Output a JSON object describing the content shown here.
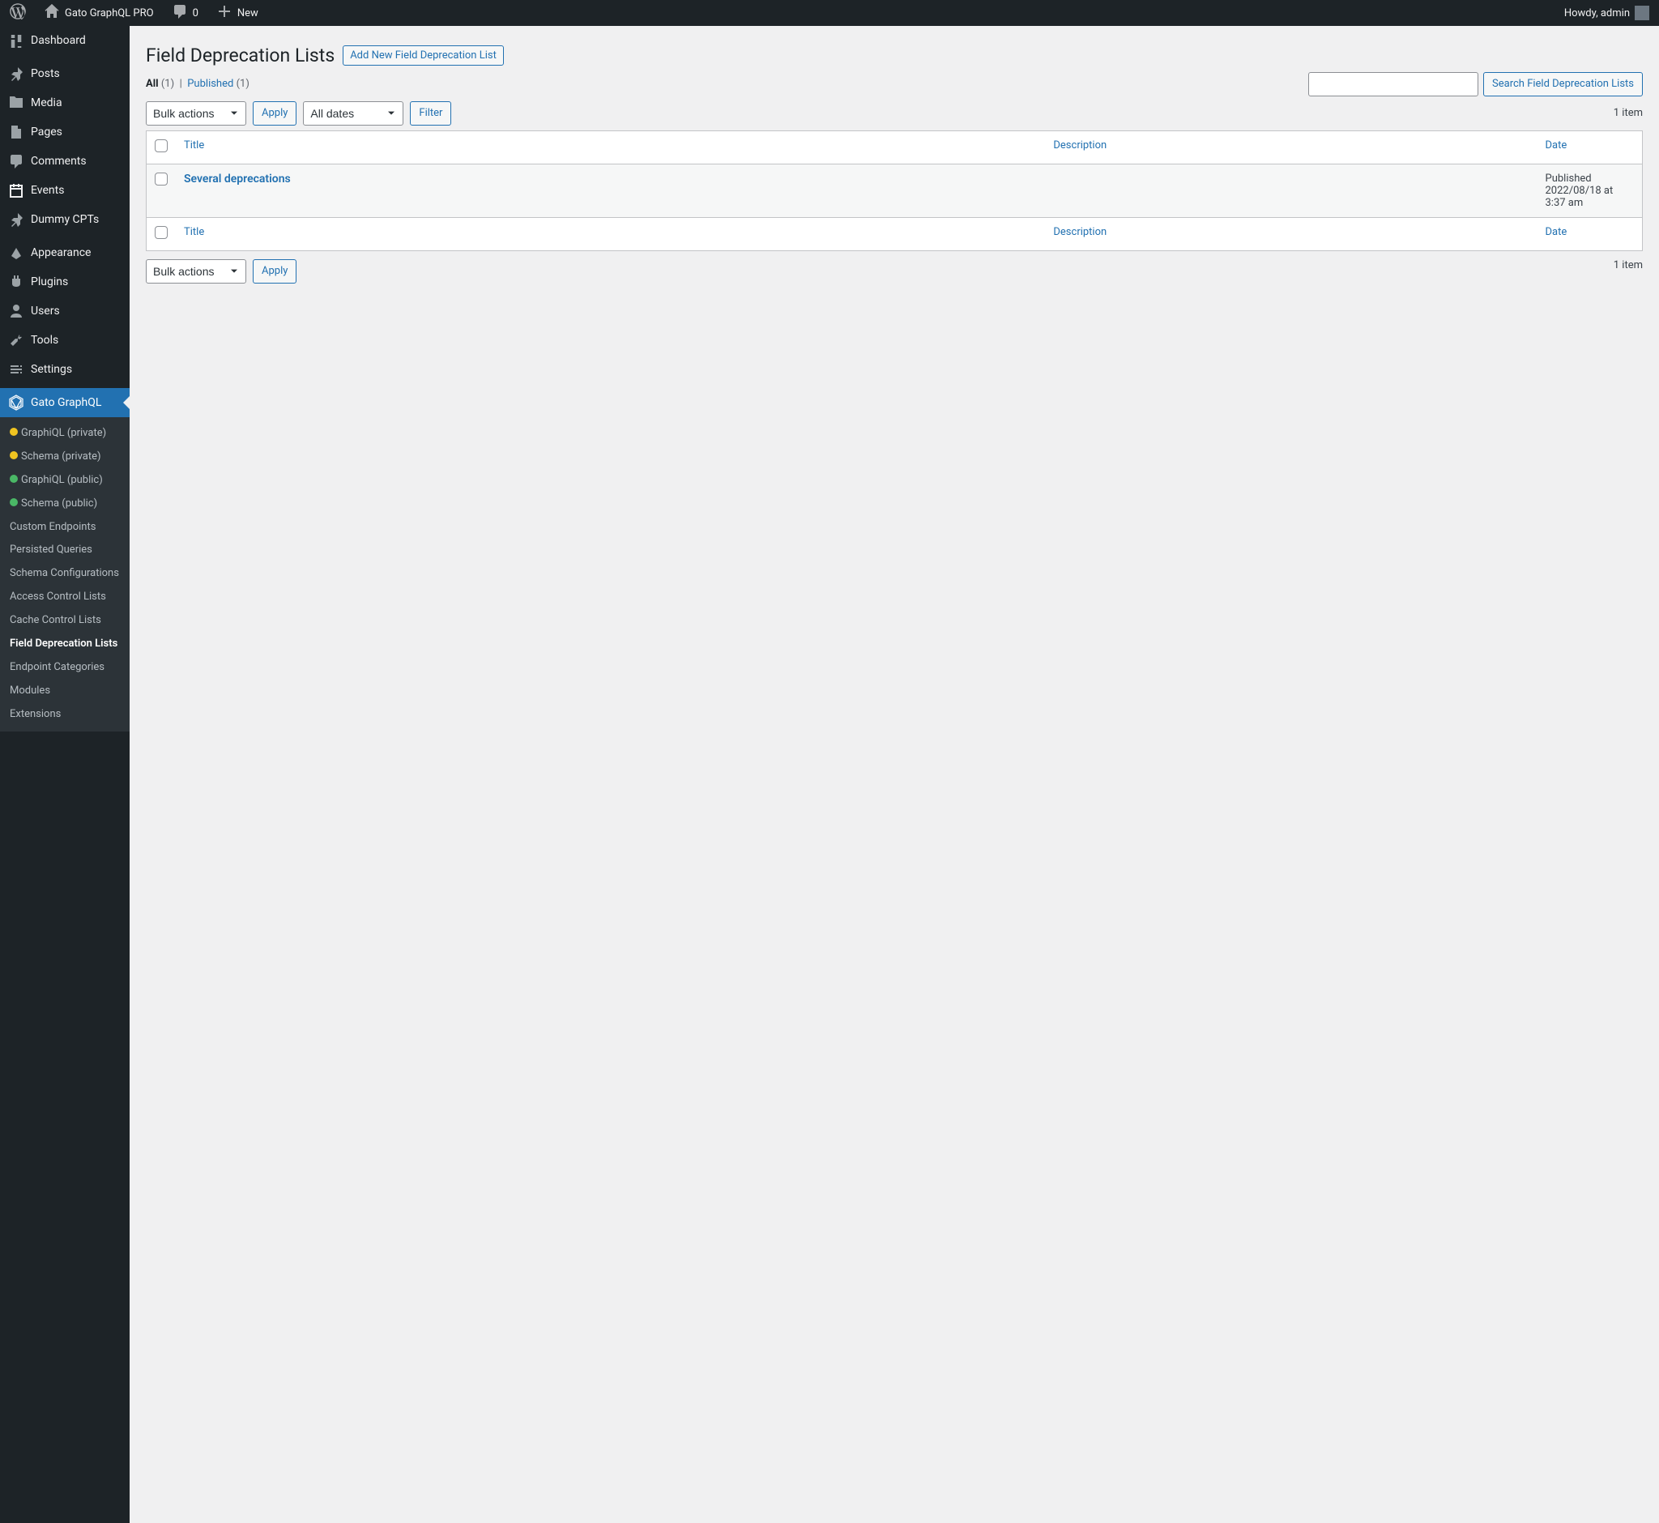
{
  "adminbar": {
    "site_name": "Gato GraphQL PRO",
    "comments_count": "0",
    "new_label": "New",
    "howdy": "Howdy, admin"
  },
  "sidebar": {
    "items": [
      {
        "label": "Dashboard",
        "icon": "dashboard-icon"
      },
      {
        "label": "Posts",
        "icon": "pin-icon"
      },
      {
        "label": "Media",
        "icon": "media-icon"
      },
      {
        "label": "Pages",
        "icon": "page-icon"
      },
      {
        "label": "Comments",
        "icon": "comment-icon"
      },
      {
        "label": "Events",
        "icon": "calendar-icon"
      },
      {
        "label": "Dummy CPTs",
        "icon": "pin-icon"
      },
      {
        "label": "Appearance",
        "icon": "appearance-icon"
      },
      {
        "label": "Plugins",
        "icon": "plugin-icon"
      },
      {
        "label": "Users",
        "icon": "user-icon"
      },
      {
        "label": "Tools",
        "icon": "tools-icon"
      },
      {
        "label": "Settings",
        "icon": "settings-icon"
      },
      {
        "label": "Gato GraphQL",
        "icon": "graphql-icon"
      }
    ],
    "submenu": [
      {
        "label": "GraphiQL (private)",
        "dot": "yellow"
      },
      {
        "label": "Schema (private)",
        "dot": "yellow"
      },
      {
        "label": "GraphiQL (public)",
        "dot": "green"
      },
      {
        "label": "Schema (public)",
        "dot": "green"
      },
      {
        "label": "Custom Endpoints"
      },
      {
        "label": "Persisted Queries"
      },
      {
        "label": "Schema Configurations"
      },
      {
        "label": "Access Control Lists"
      },
      {
        "label": "Cache Control Lists"
      },
      {
        "label": "Field Deprecation Lists",
        "current": true
      },
      {
        "label": "Endpoint Categories"
      },
      {
        "label": "Modules"
      },
      {
        "label": "Extensions"
      }
    ]
  },
  "page": {
    "title": "Field Deprecation Lists",
    "add_new": "Add New Field Deprecation List",
    "filters": {
      "all_label": "All",
      "all_count": "(1)",
      "published_label": "Published",
      "published_count": "(1)"
    },
    "bulk_label": "Bulk actions",
    "apply_label": "Apply",
    "dates_label": "All dates",
    "filter_label": "Filter",
    "search_button": "Search Field Deprecation Lists",
    "item_count": "1 item",
    "columns": {
      "title": "Title",
      "description": "Description",
      "date": "Date"
    },
    "rows": [
      {
        "title": "Several deprecations",
        "description": "",
        "date_status": "Published",
        "date_value": "2022/08/18 at 3:37 am"
      }
    ]
  }
}
